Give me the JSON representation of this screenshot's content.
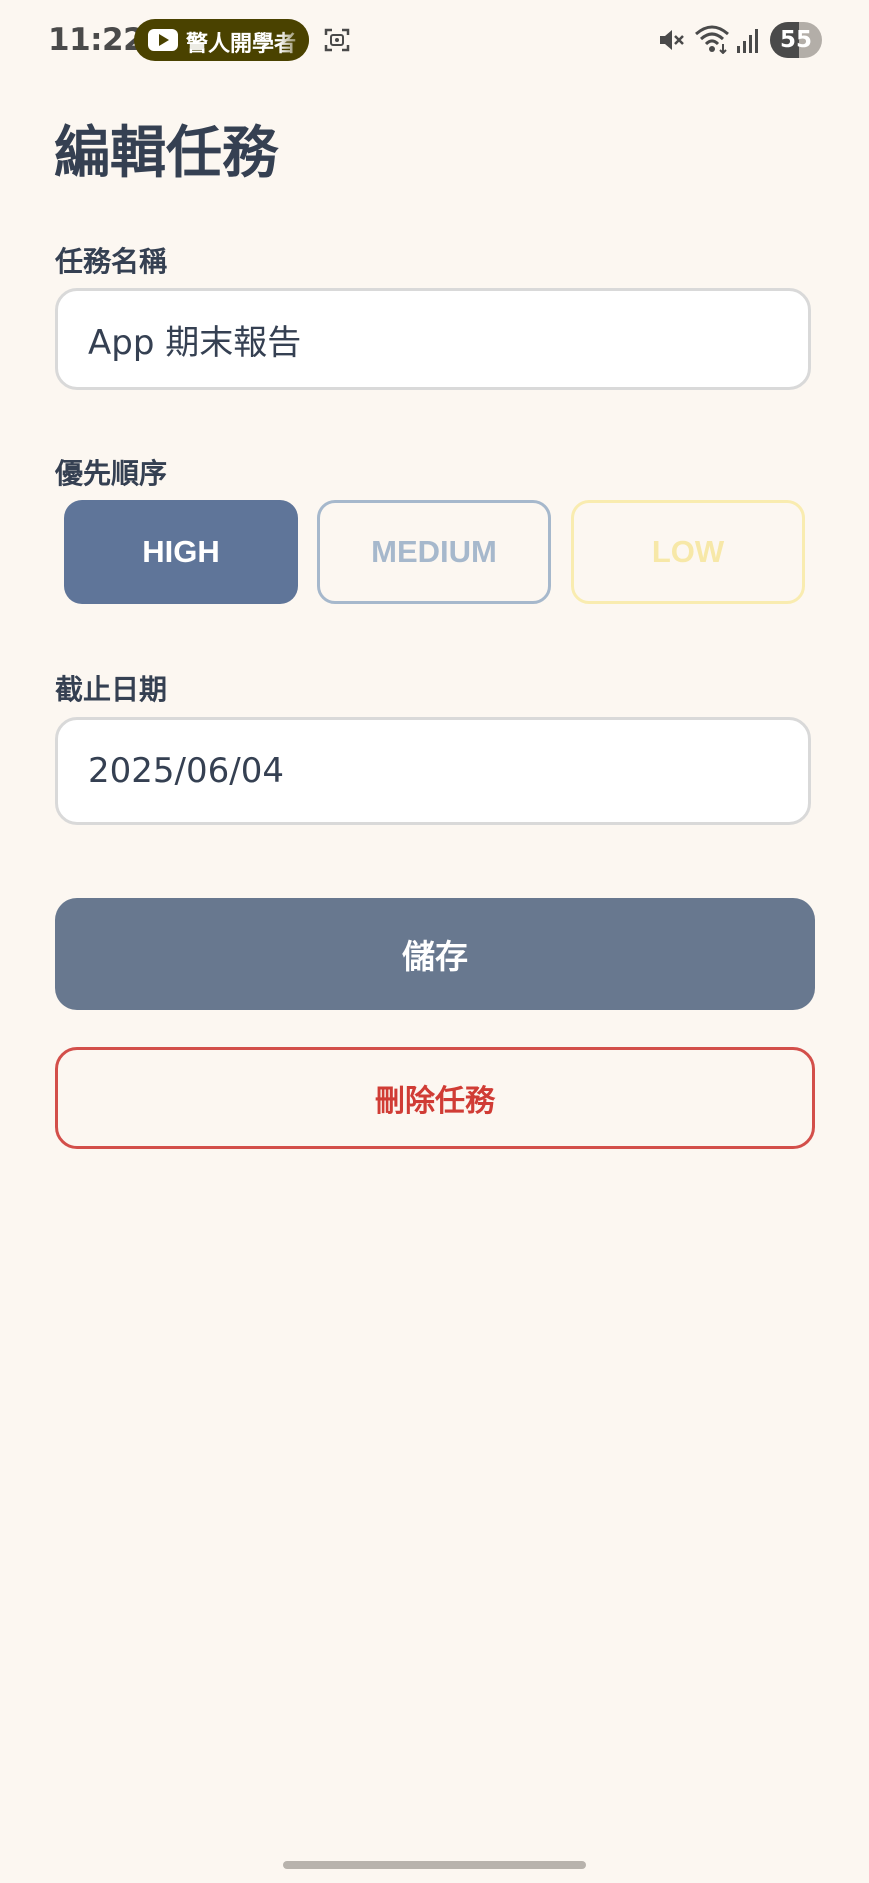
{
  "status_bar": {
    "time": "11:22",
    "youtube_notification": "警人開學者",
    "battery_level": "55",
    "icons": [
      "youtube-icon",
      "screenshot-icon",
      "mute-icon",
      "wifi-icon",
      "signal-icon",
      "battery-icon"
    ]
  },
  "page": {
    "title": "編輯任務"
  },
  "form": {
    "task_name_label": "任務名稱",
    "task_name_value": "App 期末報告",
    "priority_label": "優先順序",
    "priority_options": [
      "HIGH",
      "MEDIUM",
      "LOW"
    ],
    "priority_selected": "HIGH",
    "due_date_label": "截止日期",
    "due_date_value": "2025/06/04"
  },
  "actions": {
    "save_label": "儲存",
    "delete_label": "刪除任務"
  },
  "colors": {
    "background": "#fcf7f1",
    "primary": "#68788f",
    "high": "#5f7599",
    "medium": "#a6b8cc",
    "low": "#f9ecb0",
    "danger": "#d34f4a"
  }
}
